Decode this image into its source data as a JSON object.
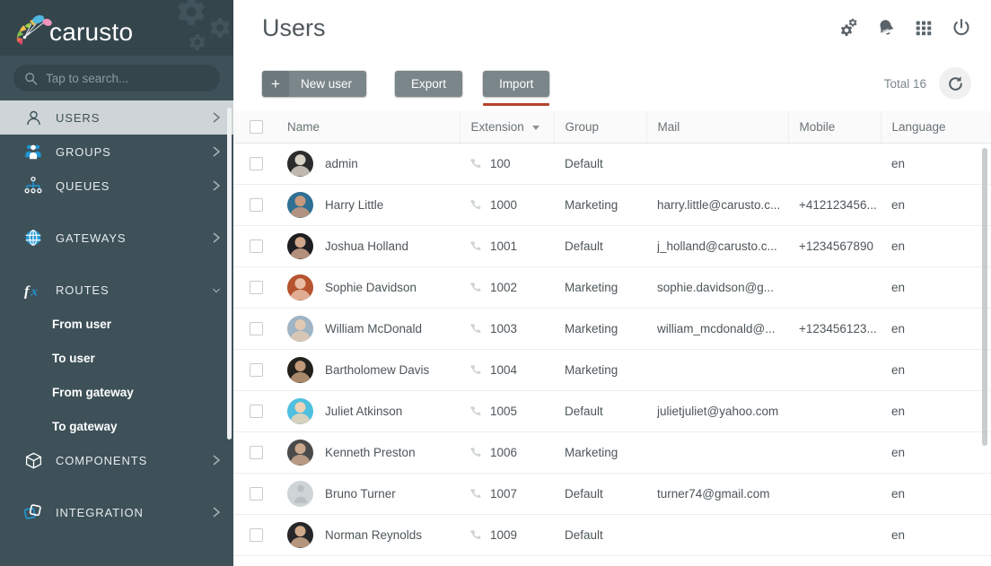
{
  "brand": {
    "name": "carusto",
    "logo_icon": "carusto-fan-logo",
    "decor_icon": "gears-decoration"
  },
  "search": {
    "placeholder": "Tap to search...",
    "value": "",
    "icon": "search-icon"
  },
  "sidebar": {
    "items": [
      {
        "label": "USERS",
        "icon": "user-icon",
        "arrow": "chevron-right-icon",
        "active": true
      },
      {
        "label": "GROUPS",
        "icon": "groups-icon",
        "arrow": "chevron-right-icon",
        "active": false
      },
      {
        "label": "QUEUES",
        "icon": "queues-icon",
        "arrow": "chevron-right-icon",
        "active": false
      },
      {
        "label": "GATEWAYS",
        "icon": "globe-icon",
        "arrow": "chevron-right-icon",
        "active": false
      },
      {
        "label": "ROUTES",
        "icon": "fx-icon",
        "arrow": "chevron-down-icon",
        "active": false
      },
      {
        "label": "COMPONENTS",
        "icon": "cube-icon",
        "arrow": "chevron-right-icon",
        "active": false
      },
      {
        "label": "INTEGRATION",
        "icon": "integration-icon",
        "arrow": "chevron-right-icon",
        "active": false
      }
    ],
    "routes_children": [
      {
        "label": "From user"
      },
      {
        "label": "To user"
      },
      {
        "label": "From gateway"
      },
      {
        "label": "To gateway"
      }
    ]
  },
  "header": {
    "title": "Users",
    "icons": [
      {
        "name": "settings-gears-icon"
      },
      {
        "name": "bell-icon"
      },
      {
        "name": "apps-grid-icon"
      },
      {
        "name": "power-icon"
      }
    ]
  },
  "toolbar": {
    "new_user_label": "New user",
    "new_user_plus": "+",
    "export_label": "Export",
    "import_label": "Import",
    "total_label": "Total 16",
    "refresh_icon": "refresh-icon",
    "accent_color": "#b6432a"
  },
  "table": {
    "columns": [
      {
        "key": "check",
        "label": ""
      },
      {
        "key": "name",
        "label": "Name"
      },
      {
        "key": "ext",
        "label": "Extension",
        "sorted": true
      },
      {
        "key": "group",
        "label": "Group"
      },
      {
        "key": "mail",
        "label": "Mail"
      },
      {
        "key": "mobile",
        "label": "Mobile"
      },
      {
        "key": "lang",
        "label": "Language"
      }
    ],
    "rows": [
      {
        "name": "admin",
        "ext": "100",
        "group": "Default",
        "mail": "",
        "mobile": "",
        "lang": "en",
        "avatar": "photo-dark"
      },
      {
        "name": "Harry Little",
        "ext": "1000",
        "group": "Marketing",
        "mail": "harry.little@carusto.c...",
        "mobile": "+412123456...",
        "lang": "en",
        "avatar": "photo-blue"
      },
      {
        "name": "Joshua Holland",
        "ext": "1001",
        "group": "Default",
        "mail": "j_holland@carusto.c...",
        "mobile": "+1234567890",
        "lang": "en",
        "avatar": "photo-dark2"
      },
      {
        "name": "Sophie Davidson",
        "ext": "1002",
        "group": "Marketing",
        "mail": "sophie.davidson@g...",
        "mobile": "",
        "lang": "en",
        "avatar": "photo-red"
      },
      {
        "name": "William McDonald",
        "ext": "1003",
        "group": "Marketing",
        "mail": "william_mcdonald@...",
        "mobile": "+123456123...",
        "lang": "en",
        "avatar": "photo-light"
      },
      {
        "name": "Bartholomew Davis",
        "ext": "1004",
        "group": "Marketing",
        "mail": "",
        "mobile": "",
        "lang": "en",
        "avatar": "photo-dark3"
      },
      {
        "name": "Juliet Atkinson",
        "ext": "1005",
        "group": "Default",
        "mail": "julietjuliet@yahoo.com",
        "mobile": "",
        "lang": "en",
        "avatar": "photo-cyan"
      },
      {
        "name": "Kenneth Preston",
        "ext": "1006",
        "group": "Marketing",
        "mail": "",
        "mobile": "",
        "lang": "en",
        "avatar": "photo-gray"
      },
      {
        "name": "Bruno Turner",
        "ext": "1007",
        "group": "Default",
        "mail": "turner74@gmail.com",
        "mobile": "",
        "lang": "en",
        "avatar": "placeholder"
      },
      {
        "name": "Norman Reynolds",
        "ext": "1009",
        "group": "Default",
        "mail": "",
        "mobile": "",
        "lang": "en",
        "avatar": "photo-dark4"
      }
    ]
  }
}
